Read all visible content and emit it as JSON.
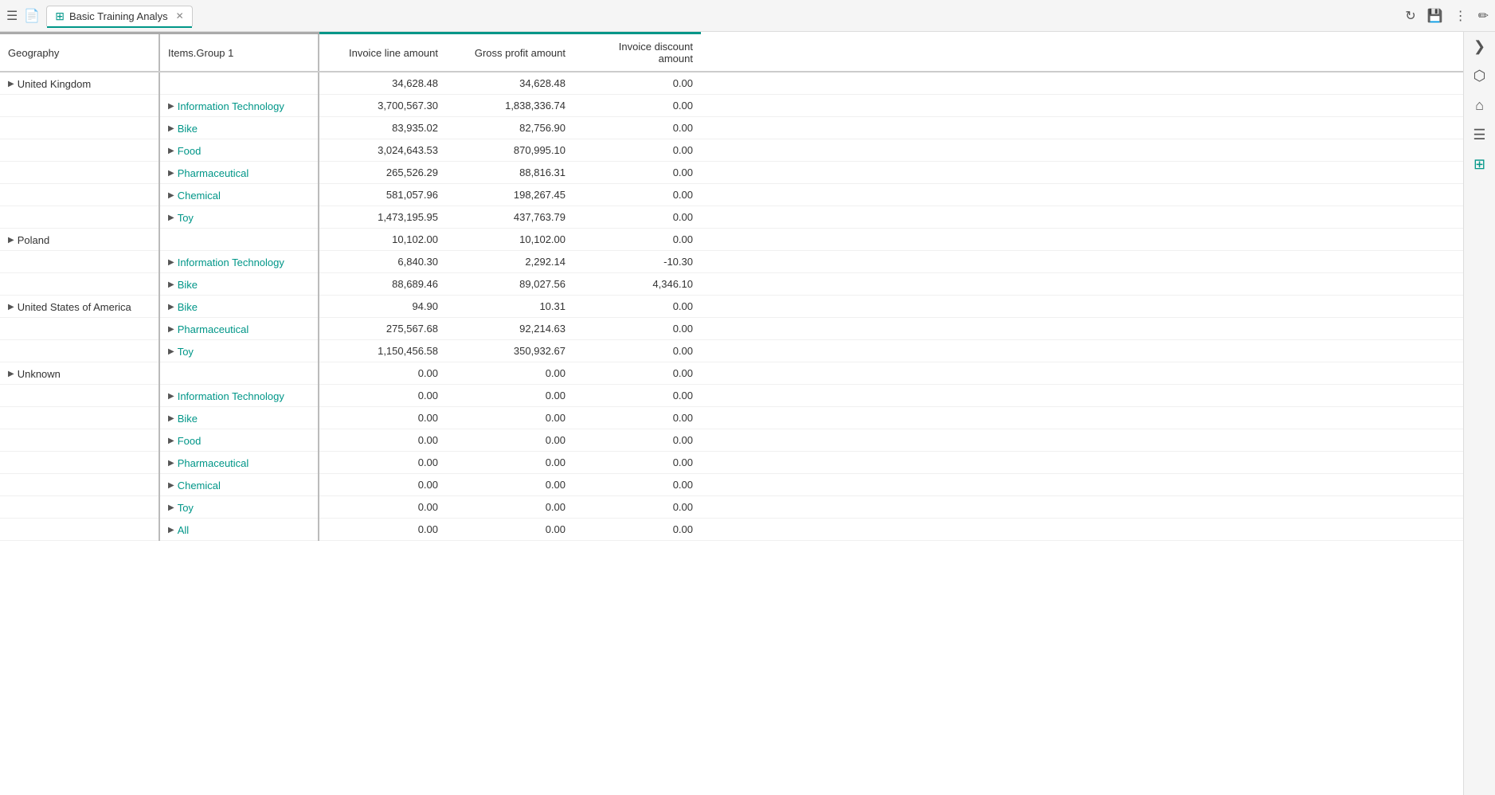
{
  "topbar": {
    "tab_title": "Basic Training Analys",
    "tab_icon": "⊞",
    "buttons": {
      "menu": "☰",
      "file": "📄",
      "refresh": "↻",
      "save": "💾",
      "more": "⋮",
      "edit": "✏"
    }
  },
  "side_icons": [
    {
      "name": "chevron-right",
      "icon": "❯",
      "active": false
    },
    {
      "name": "cube",
      "icon": "⬡",
      "active": false
    },
    {
      "name": "home",
      "icon": "⌂",
      "active": false
    },
    {
      "name": "list",
      "icon": "☰",
      "active": false
    },
    {
      "name": "grid",
      "icon": "⊞",
      "active": true
    }
  ],
  "table": {
    "columns": [
      {
        "key": "geography",
        "label": "Geography"
      },
      {
        "key": "items_group",
        "label": "Items.Group 1"
      },
      {
        "key": "invoice_line",
        "label": "Invoice line amount"
      },
      {
        "key": "gross_profit",
        "label": "Gross profit amount"
      },
      {
        "key": "invoice_discount",
        "label": "Invoice discount amount"
      }
    ],
    "rows": [
      {
        "geography": "United Kingdom",
        "items_group": "",
        "invoice_line": "34,628.48",
        "gross_profit": "34,628.48",
        "invoice_discount": "0.00",
        "geo_expand": true,
        "grp_expand": true,
        "grp_link": false
      },
      {
        "geography": "",
        "items_group": "Information Technology",
        "invoice_line": "3,700,567.30",
        "gross_profit": "1,838,336.74",
        "invoice_discount": "0.00",
        "geo_expand": false,
        "grp_expand": true,
        "grp_link": true
      },
      {
        "geography": "",
        "items_group": "Bike",
        "invoice_line": "83,935.02",
        "gross_profit": "82,756.90",
        "invoice_discount": "0.00",
        "geo_expand": false,
        "grp_expand": true,
        "grp_link": true
      },
      {
        "geography": "",
        "items_group": "Food",
        "invoice_line": "3,024,643.53",
        "gross_profit": "870,995.10",
        "invoice_discount": "0.00",
        "geo_expand": false,
        "grp_expand": true,
        "grp_link": true
      },
      {
        "geography": "",
        "items_group": "Pharmaceutical",
        "invoice_line": "265,526.29",
        "gross_profit": "88,816.31",
        "invoice_discount": "0.00",
        "geo_expand": false,
        "grp_expand": true,
        "grp_link": true
      },
      {
        "geography": "",
        "items_group": "Chemical",
        "invoice_line": "581,057.96",
        "gross_profit": "198,267.45",
        "invoice_discount": "0.00",
        "geo_expand": false,
        "grp_expand": true,
        "grp_link": true
      },
      {
        "geography": "",
        "items_group": "Toy",
        "invoice_line": "1,473,195.95",
        "gross_profit": "437,763.79",
        "invoice_discount": "0.00",
        "geo_expand": false,
        "grp_expand": true,
        "grp_link": true
      },
      {
        "geography": "Poland",
        "items_group": "",
        "invoice_line": "10,102.00",
        "gross_profit": "10,102.00",
        "invoice_discount": "0.00",
        "geo_expand": true,
        "grp_expand": true,
        "grp_link": false
      },
      {
        "geography": "",
        "items_group": "Information Technology",
        "invoice_line": "6,840.30",
        "gross_profit": "2,292.14",
        "invoice_discount": "-10.30",
        "geo_expand": false,
        "grp_expand": true,
        "grp_link": true
      },
      {
        "geography": "",
        "items_group": "Bike",
        "invoice_line": "88,689.46",
        "gross_profit": "89,027.56",
        "invoice_discount": "4,346.10",
        "geo_expand": false,
        "grp_expand": true,
        "grp_link": true
      },
      {
        "geography": "United States of America",
        "items_group": "Bike",
        "invoice_line": "94.90",
        "gross_profit": "10.31",
        "invoice_discount": "0.00",
        "geo_expand": true,
        "grp_expand": true,
        "grp_link": true
      },
      {
        "geography": "",
        "items_group": "Pharmaceutical",
        "invoice_line": "275,567.68",
        "gross_profit": "92,214.63",
        "invoice_discount": "0.00",
        "geo_expand": false,
        "grp_expand": true,
        "grp_link": true
      },
      {
        "geography": "",
        "items_group": "Toy",
        "invoice_line": "1,150,456.58",
        "gross_profit": "350,932.67",
        "invoice_discount": "0.00",
        "geo_expand": false,
        "grp_expand": true,
        "grp_link": true
      },
      {
        "geography": "Unknown",
        "items_group": "",
        "invoice_line": "0.00",
        "gross_profit": "0.00",
        "invoice_discount": "0.00",
        "geo_expand": true,
        "grp_expand": true,
        "grp_link": false
      },
      {
        "geography": "",
        "items_group": "Information Technology",
        "invoice_line": "0.00",
        "gross_profit": "0.00",
        "invoice_discount": "0.00",
        "geo_expand": false,
        "grp_expand": true,
        "grp_link": true
      },
      {
        "geography": "",
        "items_group": "Bike",
        "invoice_line": "0.00",
        "gross_profit": "0.00",
        "invoice_discount": "0.00",
        "geo_expand": false,
        "grp_expand": true,
        "grp_link": true
      },
      {
        "geography": "",
        "items_group": "Food",
        "invoice_line": "0.00",
        "gross_profit": "0.00",
        "invoice_discount": "0.00",
        "geo_expand": false,
        "grp_expand": true,
        "grp_link": true
      },
      {
        "geography": "",
        "items_group": "Pharmaceutical",
        "invoice_line": "0.00",
        "gross_profit": "0.00",
        "invoice_discount": "0.00",
        "geo_expand": false,
        "grp_expand": true,
        "grp_link": true
      },
      {
        "geography": "",
        "items_group": "Chemical",
        "invoice_line": "0.00",
        "gross_profit": "0.00",
        "invoice_discount": "0.00",
        "geo_expand": false,
        "grp_expand": true,
        "grp_link": true
      },
      {
        "geography": "",
        "items_group": "Toy",
        "invoice_line": "0.00",
        "gross_profit": "0.00",
        "invoice_discount": "0.00",
        "geo_expand": false,
        "grp_expand": true,
        "grp_link": true
      },
      {
        "geography": "",
        "items_group": "All",
        "invoice_line": "0.00",
        "gross_profit": "0.00",
        "invoice_discount": "0.00",
        "geo_expand": false,
        "grp_expand": true,
        "grp_link": true
      }
    ]
  }
}
